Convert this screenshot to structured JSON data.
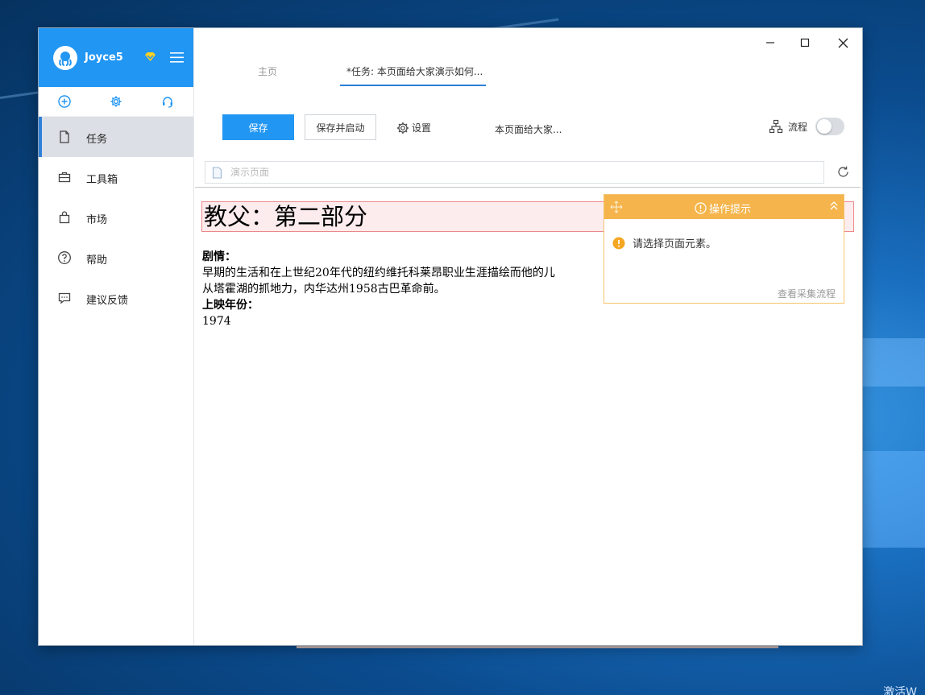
{
  "user": {
    "name": "Joyce5"
  },
  "nav": {
    "items": [
      {
        "label": "任务"
      },
      {
        "label": "工具箱"
      },
      {
        "label": "市场"
      },
      {
        "label": "帮助"
      },
      {
        "label": "建议反馈"
      }
    ]
  },
  "tabs": {
    "home": "主页",
    "task": "*任务: 本页面给大家演示如何..."
  },
  "toolbar": {
    "save_label": "保存",
    "save_start_label": "保存并启动",
    "settings_label": "设置",
    "task_name": "本页面给大家...",
    "flow_label": "流程",
    "flow_enabled": false
  },
  "urlbar": {
    "placeholder": "演示页面"
  },
  "page": {
    "title": "教父：第二部分",
    "plot_label": "剧情：",
    "plot_line1": "早期的生活和在上世纪20年代的纽约维托科莱昂职业生涯描绘而他的儿",
    "plot_line2": "从塔霍湖的抓地力，内华达州1958古巴革命前。",
    "year_label": "上映年份：",
    "year_value": "1974"
  },
  "tip": {
    "title": "操作提示",
    "message": "请选择页面元素。",
    "link": "查看采集流程"
  },
  "desktop": {
    "watermark": "激活W"
  },
  "colors": {
    "primary": "#2196f3",
    "tip_header": "#f5b54c",
    "highlight_border": "#ee8888",
    "highlight_bg": "#fdeced"
  }
}
